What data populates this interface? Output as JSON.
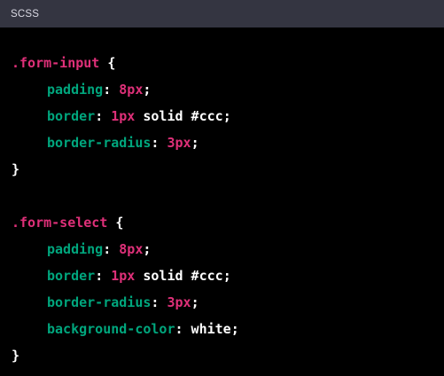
{
  "header": {
    "language": "SCSS"
  },
  "colors": {
    "selector": "#df3079",
    "property": "#00a67d",
    "number": "#df3079",
    "text": "#ffffff",
    "header_bg": "#343541",
    "code_bg": "#000000"
  },
  "code": {
    "rule1": {
      "selector": ".form-input",
      "open": " {",
      "decls": [
        {
          "prop": "padding",
          "num": "8px",
          "rest": ""
        },
        {
          "prop": "border",
          "num": "1px",
          "rest": " solid #ccc"
        },
        {
          "prop": "border-radius",
          "num": "3px",
          "rest": ""
        }
      ],
      "close": "}"
    },
    "rule2": {
      "selector": ".form-select",
      "open": " {",
      "decls": [
        {
          "prop": "padding",
          "num": "8px",
          "rest": ""
        },
        {
          "prop": "border",
          "num": "1px",
          "rest": " solid #ccc"
        },
        {
          "prop": "border-radius",
          "num": "3px",
          "rest": ""
        },
        {
          "prop": "background-color",
          "num": "",
          "rest": " white"
        }
      ],
      "close": "}"
    }
  }
}
